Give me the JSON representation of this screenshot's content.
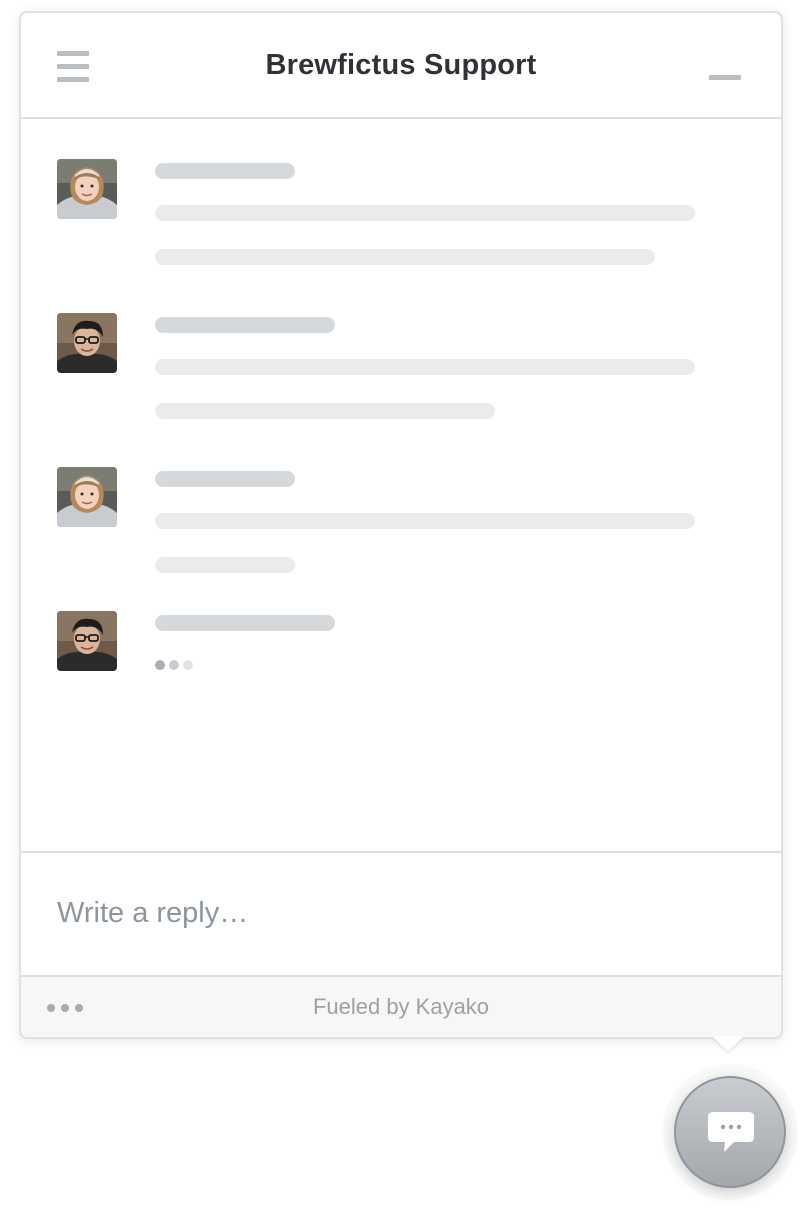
{
  "header": {
    "title": "Brewfictus Support",
    "menu_icon": "hamburger-menu-icon",
    "minimize_icon": "minimize-icon"
  },
  "messages": [
    {
      "author_avatar": "woman-with-headband-avatar",
      "loading": true
    },
    {
      "author_avatar": "man-with-glasses-avatar",
      "loading": true
    },
    {
      "author_avatar": "woman-with-headband-avatar",
      "loading": true
    },
    {
      "author_avatar": "man-with-glasses-avatar",
      "loading": true,
      "typing": true
    }
  ],
  "composer": {
    "placeholder": "Write a reply…"
  },
  "footer": {
    "more_icon": "more-options-icon",
    "powered_by": "Fueled by Kayako"
  },
  "launcher": {
    "icon": "chat-bubble-icon"
  },
  "colors": {
    "title_text": "#2f3338",
    "skeleton_name": "#d6d9dc",
    "skeleton_line": "#e9ebed",
    "border": "#dcdfe2",
    "footer_bg": "#f7f7f7",
    "launcher": "#b5b9be"
  }
}
